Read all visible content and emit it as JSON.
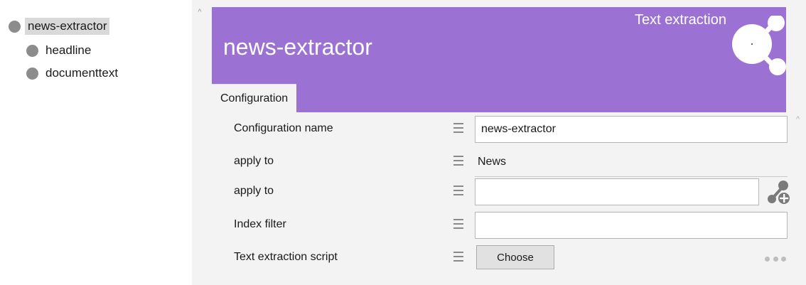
{
  "tree": {
    "items": [
      {
        "label": "news-extractor",
        "level": 0,
        "selected": true
      },
      {
        "label": "headline",
        "level": 1
      },
      {
        "label": "documenttext",
        "level": 1
      }
    ]
  },
  "header": {
    "title": "news-extractor",
    "type_label": "Text extraction",
    "color": "#9b72d4",
    "logo_icon": "share-network-icon"
  },
  "tabs": [
    {
      "label": "Configuration",
      "active": true
    }
  ],
  "form": {
    "rows": [
      {
        "label": "Configuration name",
        "kind": "input",
        "value": "news-extractor"
      },
      {
        "label": "apply to",
        "kind": "text",
        "value": "News"
      },
      {
        "label": "apply to",
        "kind": "input",
        "value": "",
        "action_icon": "add-link-icon"
      },
      {
        "label": "Index filter",
        "kind": "input",
        "value": ""
      },
      {
        "label": "Text extraction script",
        "kind": "button",
        "button_label": "Choose",
        "action_icon": "more-icon"
      }
    ]
  }
}
